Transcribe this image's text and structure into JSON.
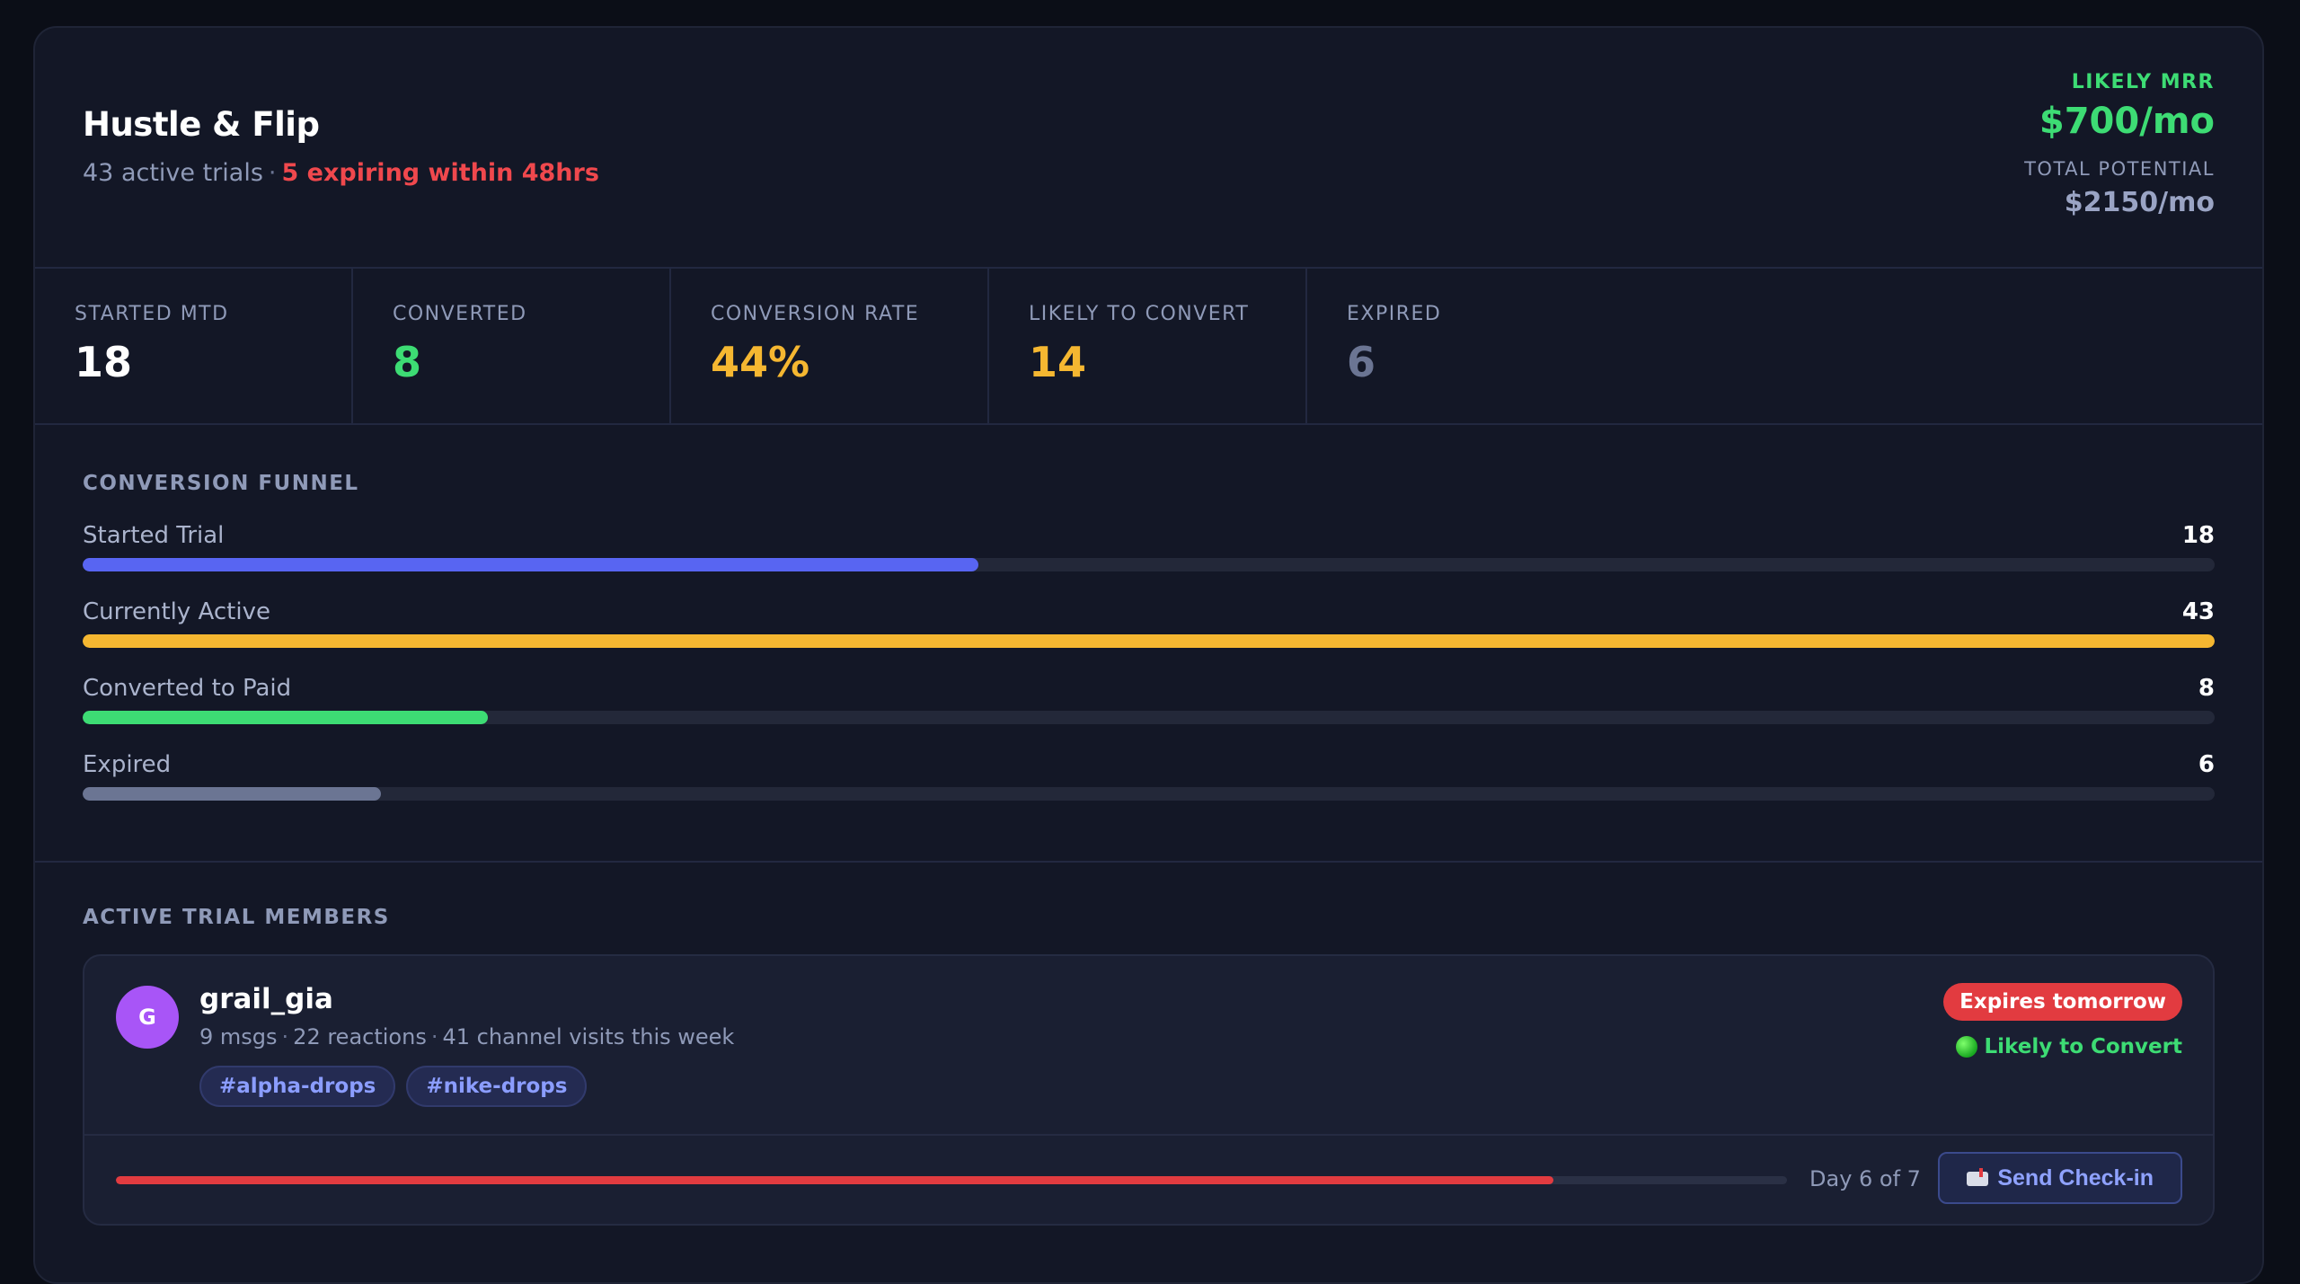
{
  "header": {
    "title": "Hustle & Flip",
    "active_trials": "43 active trials",
    "separator": "·",
    "expiring": "5 expiring within 48hrs",
    "likely_mrr_label": "LIKELY MRR",
    "likely_mrr_value": "$700/mo",
    "total_potential_label": "TOTAL POTENTIAL",
    "total_potential_value": "$2150/mo"
  },
  "stats": [
    {
      "label": "STARTED MTD",
      "value": "18",
      "color": "#ffffff"
    },
    {
      "label": "CONVERTED",
      "value": "8",
      "color": "#3ddc74"
    },
    {
      "label": "CONVERSION RATE",
      "value": "44%",
      "color": "#f5b731"
    },
    {
      "label": "LIKELY TO CONVERT",
      "value": "14",
      "color": "#f5b731"
    },
    {
      "label": "EXPIRED",
      "value": "6",
      "color": "#6b7593"
    }
  ],
  "funnel": {
    "title": "CONVERSION FUNNEL",
    "rows": [
      {
        "label": "Started Trial",
        "value": "18",
        "fraction": 0.42,
        "color": "#5865f2"
      },
      {
        "label": "Currently Active",
        "value": "43",
        "fraction": 1.0,
        "color": "#f5b731"
      },
      {
        "label": "Converted to Paid",
        "value": "8",
        "fraction": 0.19,
        "color": "#3ddc74"
      },
      {
        "label": "Expired",
        "value": "6",
        "fraction": 0.14,
        "color": "#6b7593"
      }
    ]
  },
  "members": {
    "title": "ACTIVE TRIAL MEMBERS",
    "items": [
      {
        "avatar_initial": "G",
        "name": "grail_gia",
        "msgs": "9 msgs",
        "reactions": "22 reactions",
        "visits": "41 channel visits this week",
        "tags": [
          "#alpha-drops",
          "#nike-drops"
        ],
        "expires_badge": "Expires tomorrow",
        "likely_label": "Likely to Convert",
        "day_label": "Day 6 of 7",
        "day_progress": 0.86,
        "checkin_label": "Send Check-in",
        "checkin_icon": "mailbox-icon"
      }
    ]
  }
}
